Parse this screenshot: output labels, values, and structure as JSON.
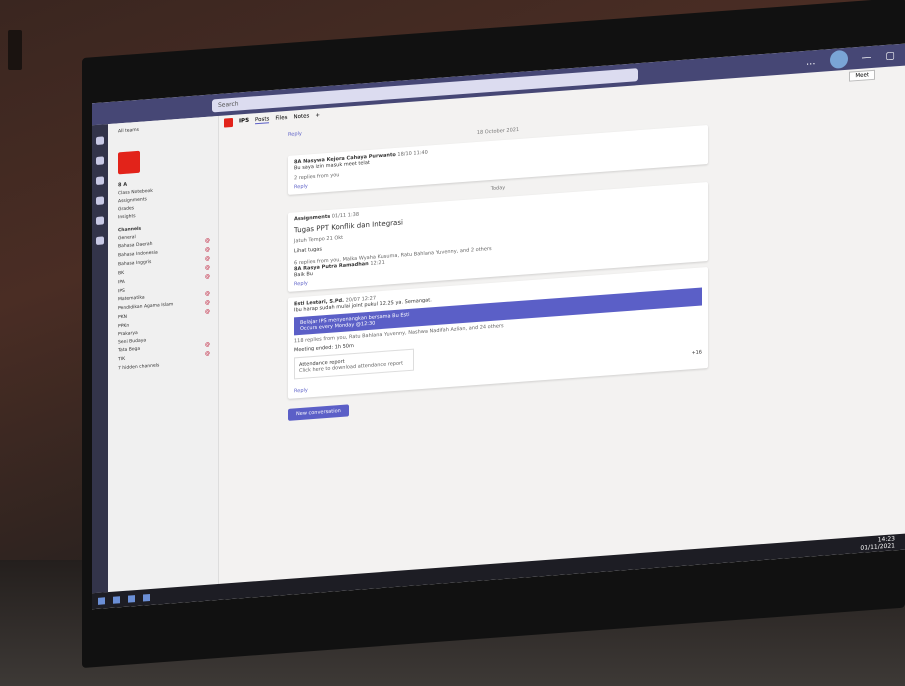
{
  "topbar": {
    "search_placeholder": "Search",
    "more": "...",
    "minimize": "—",
    "restore": "▢"
  },
  "channel_list": {
    "back": "All teams",
    "team_name": "8 A",
    "nav": [
      "Class Notebook",
      "Assignments",
      "Grades",
      "Insights"
    ],
    "channels_heading": "Channels",
    "channels": [
      {
        "name": "General",
        "badge": ""
      },
      {
        "name": "Bahasa Daerah",
        "badge": "@"
      },
      {
        "name": "Bahasa Indonesia",
        "badge": "@"
      },
      {
        "name": "Bahasa Inggris",
        "badge": "@"
      },
      {
        "name": "BK",
        "badge": "@"
      },
      {
        "name": "IPA",
        "badge": "@"
      },
      {
        "name": "IPS",
        "badge": ""
      },
      {
        "name": "Matematika",
        "badge": "@"
      },
      {
        "name": "Pendidikan Agama Islam",
        "badge": "@"
      },
      {
        "name": "PKN",
        "badge": "@"
      },
      {
        "name": "PPKn",
        "badge": ""
      },
      {
        "name": "Prakarya",
        "badge": ""
      },
      {
        "name": "Seni Budaya",
        "badge": ""
      },
      {
        "name": "Tata Boga",
        "badge": "@"
      },
      {
        "name": "TIK",
        "badge": "@"
      },
      {
        "name": "7 hidden channels",
        "badge": ""
      }
    ]
  },
  "header": {
    "channel": "IPS",
    "tabs": [
      "Posts",
      "Files",
      "Notes"
    ],
    "add_tab": "+",
    "meet": "Meet",
    "info": "ⓘ"
  },
  "posts": {
    "reply_label": "Reply",
    "date_1": "18 October 2021",
    "post1": {
      "author": "8A Nasywa Kejora Cahaya Purwanto",
      "time": "18/10 11:40",
      "text": "Bu saya izin masuk meet telat",
      "replies": "2 replies from you"
    },
    "date_2": "Today",
    "post2": {
      "author": "Assignments",
      "time": "01/11 1:38",
      "title": "Tugas PPT Konflik dan Integrasi",
      "due": "Jatuh Tempo 21 Okt",
      "button": "Lihat tugas",
      "replies": "6 replies from you, Malka Wyaha Kusuma, Ratu Bahlana Yuvenny, and 2 others",
      "last_reply_author": "8A Rasya Putra Ramadhan",
      "last_reply_time": "12:21",
      "last_reply_text": "Baik Bu"
    },
    "post3": {
      "author": "Esti Lestari, S.Pd.",
      "time": "20/07 12:27",
      "text": "Ibu harap sudah mulai joint pukul 12.25 ya. Semangat.",
      "meeting_title": "Belajar IPS menyenangkan bersama Bu Esti",
      "meeting_sub": "Occurs every Monday @12:30",
      "replies": "118 replies from you, Ratu Bahlana Yuvenny, Nashwa Nadifah Azlian, and 24 others",
      "ended": "Meeting ended: 1h 50m",
      "report_title": "Attendance report",
      "report_sub": "Click here to download attendance report",
      "more_people": "+16"
    },
    "new_conversation": "New conversation"
  },
  "taskbar": {
    "time": "14:23",
    "date": "01/11/2021"
  }
}
